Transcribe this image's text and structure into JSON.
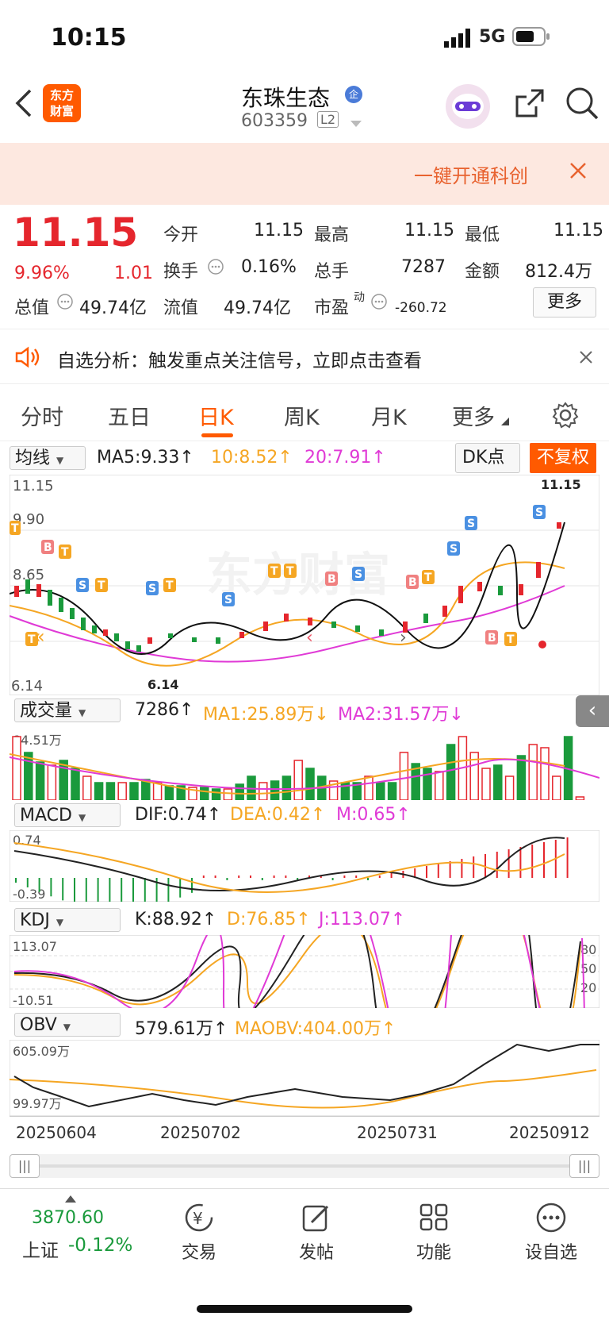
{
  "status": {
    "time": "10:15",
    "network": "5G"
  },
  "nav": {
    "title": "东珠生态",
    "code": "603359",
    "level": "L2",
    "logo_text": [
      "东方",
      "财富"
    ],
    "enterprise_badge": "企"
  },
  "banner": {
    "text": "一键开通科创"
  },
  "quote": {
    "price": "11.15",
    "change_pct": "9.96%",
    "change": "1.01",
    "open_label": "今开",
    "open": "11.15",
    "high_label": "最高",
    "high": "11.15",
    "low_label": "最低",
    "low": "11.15",
    "turnover_label": "换手",
    "turnover": "0.16%",
    "volume_label": "总手",
    "volume": "7287",
    "amount_label": "金额",
    "amount": "812.4万",
    "mcap_label": "总值",
    "mcap": "49.74亿",
    "float_label": "流值",
    "float_cap": "49.74亿",
    "pe_label": "市盈",
    "pe_sup": "动",
    "pe": "-260.72",
    "more": "更多"
  },
  "notice": {
    "text": "自选分析：触发重点关注信号，立即点击查看"
  },
  "tabs": [
    "分时",
    "五日",
    "日K",
    "周K",
    "月K",
    "更多"
  ],
  "active_tab": "日K",
  "kline": {
    "selector": "均线",
    "ma5": "MA5:9.33↑",
    "ma10": "10:8.52↑",
    "ma20": "20:7.91↑",
    "dk_label": "DK点",
    "fq_label": "不复权",
    "axis_high": "11.15",
    "axis_mid": "9.90",
    "axis_mid2": "8.65",
    "axis_low": "6.14",
    "last_label": "11.15",
    "low_label": "6.14",
    "watermark": "东方财富"
  },
  "volume": {
    "selector": "成交量",
    "value": "7286↑",
    "ma1": "MA1:25.89万↓",
    "ma2": "MA2:31.57万↓",
    "axis_top": "84.51万"
  },
  "macd": {
    "selector": "MACD",
    "dif": "DIF:0.74↑",
    "dea": "DEA:0.42↑",
    "m": "M:0.65↑",
    "axis_top": "0.74",
    "axis_bottom": "-0.39"
  },
  "kdj": {
    "selector": "KDJ",
    "k": "K:88.92↑",
    "d": "D:76.85↑",
    "j": "J:113.07↑",
    "axis_top": "113.07",
    "axis_bottom": "-10.51",
    "lv80": "80",
    "lv50": "50",
    "lv20": "20"
  },
  "obv": {
    "selector": "OBV",
    "value": "579.61万↑",
    "maobv": "MAOBV:404.00万↑",
    "axis_top": "605.09万",
    "axis_bottom": "99.97万"
  },
  "dates": [
    "20250604",
    "20250702",
    "20250731",
    "20250912"
  ],
  "bottom": {
    "index_value": "3870.60",
    "index_name": "上证",
    "index_change": "-0.12%",
    "trade": "交易",
    "post": "发帖",
    "func": "功能",
    "fav": "设自选"
  },
  "colors": {
    "up": "#e5262d",
    "down": "#1a9a3c",
    "accent": "#ff5a00",
    "ma10": "#f5a623",
    "ma20": "#e03ad6"
  }
}
